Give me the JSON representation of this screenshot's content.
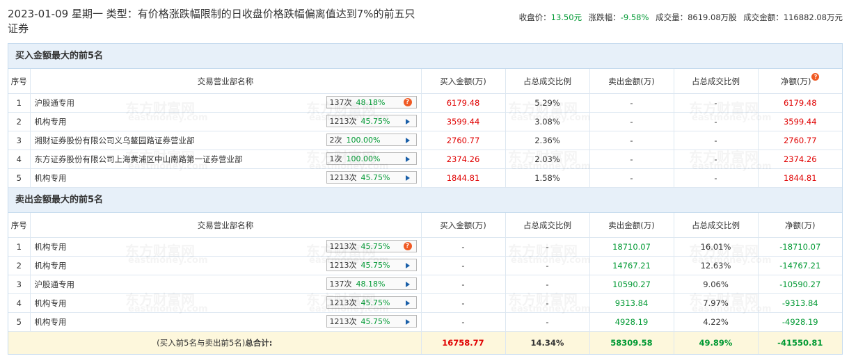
{
  "header": {
    "title": "2023-01-09 星期一 类型：有价格涨跌幅限制的日收盘价格跌幅偏离值达到7%的前五只证券",
    "close_label": "收盘价：",
    "close_value": "13.50元",
    "change_label": "涨跌幅：",
    "change_value": "-9.58%",
    "volume_label": "成交量：",
    "volume_value": "8619.08万股",
    "amount_label": "成交金额：",
    "amount_value": "116882.08万元"
  },
  "columns": [
    "序号",
    "交易营业部名称",
    "买入金额(万)",
    "占总成交比例",
    "卖出金额(万)",
    "占总成交比例",
    "净额(万)"
  ],
  "buy": {
    "title": "买入金额最大的前5名",
    "rows": [
      {
        "idx": "1",
        "name": "沪股通专用",
        "cnt": "137次",
        "pct": "48.18%",
        "icon": "question",
        "buy": "6179.48",
        "buy_ratio": "5.29%",
        "sell": "-",
        "sell_ratio": "-",
        "net": "6179.48"
      },
      {
        "idx": "2",
        "name": "机构专用",
        "cnt": "1213次",
        "pct": "45.75%",
        "icon": "arrow",
        "buy": "3599.44",
        "buy_ratio": "3.08%",
        "sell": "-",
        "sell_ratio": "-",
        "net": "3599.44"
      },
      {
        "idx": "3",
        "name": "湘财证券股份有限公司义乌鳌园路证券营业部",
        "cnt": "2次",
        "pct": "100.00%",
        "icon": "arrow",
        "buy": "2760.77",
        "buy_ratio": "2.36%",
        "sell": "-",
        "sell_ratio": "-",
        "net": "2760.77"
      },
      {
        "idx": "4",
        "name": "东方证券股份有限公司上海黄浦区中山南路第一证券营业部",
        "cnt": "1次",
        "pct": "100.00%",
        "icon": "arrow",
        "buy": "2374.26",
        "buy_ratio": "2.03%",
        "sell": "-",
        "sell_ratio": "-",
        "net": "2374.26"
      },
      {
        "idx": "5",
        "name": "机构专用",
        "cnt": "1213次",
        "pct": "45.75%",
        "icon": "arrow",
        "buy": "1844.81",
        "buy_ratio": "1.58%",
        "sell": "-",
        "sell_ratio": "-",
        "net": "1844.81"
      }
    ]
  },
  "sell": {
    "title": "卖出金额最大的前5名",
    "rows": [
      {
        "idx": "1",
        "name": "机构专用",
        "cnt": "1213次",
        "pct": "45.75%",
        "icon": "question",
        "buy": "-",
        "buy_ratio": "-",
        "sell": "18710.07",
        "sell_ratio": "16.01%",
        "net": "-18710.07"
      },
      {
        "idx": "2",
        "name": "机构专用",
        "cnt": "1213次",
        "pct": "45.75%",
        "icon": "arrow",
        "buy": "-",
        "buy_ratio": "-",
        "sell": "14767.21",
        "sell_ratio": "12.63%",
        "net": "-14767.21"
      },
      {
        "idx": "3",
        "name": "沪股通专用",
        "cnt": "137次",
        "pct": "48.18%",
        "icon": "arrow",
        "buy": "-",
        "buy_ratio": "-",
        "sell": "10590.27",
        "sell_ratio": "9.06%",
        "net": "-10590.27"
      },
      {
        "idx": "4",
        "name": "机构专用",
        "cnt": "1213次",
        "pct": "45.75%",
        "icon": "arrow",
        "buy": "-",
        "buy_ratio": "-",
        "sell": "9313.84",
        "sell_ratio": "7.97%",
        "net": "-9313.84"
      },
      {
        "idx": "5",
        "name": "机构专用",
        "cnt": "1213次",
        "pct": "45.75%",
        "icon": "arrow",
        "buy": "-",
        "buy_ratio": "-",
        "sell": "4928.19",
        "sell_ratio": "4.22%",
        "net": "-4928.19"
      }
    ]
  },
  "total": {
    "label_prefix": "(买入前5名与卖出前5名)",
    "label_bold": "总合计:",
    "buy": "16758.77",
    "buy_ratio": "14.34%",
    "sell": "58309.58",
    "sell_ratio": "49.89%",
    "net": "-41550.81"
  },
  "watermark": {
    "cn": "东方财富网",
    "en": "eastmoney.com"
  },
  "colors": {
    "red": "#e00000",
    "green": "#009933",
    "section_bg": "#e7f0f9",
    "total_bg": "#fdf7dc",
    "border": "#c6dbee"
  }
}
